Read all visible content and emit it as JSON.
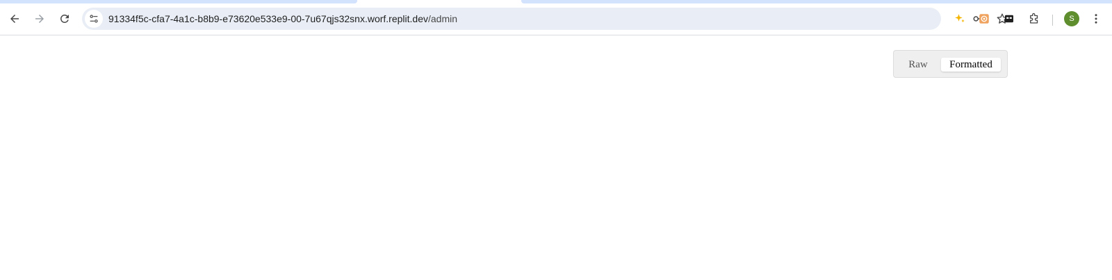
{
  "browser": {
    "url_host": "91334f5c-cfa7-4a1c-b8b9-e73620e533e9-00-7u67qjs32snx.worf.replit.dev",
    "url_path": "/admin",
    "profile_initial": "S",
    "icons": {
      "back": "back-arrow-icon",
      "forward": "forward-arrow-icon",
      "reload": "reload-icon",
      "site_info": "tune-icon",
      "password": "key-icon",
      "bookmark": "star-icon",
      "extensions": [
        "sparkle-icon",
        "orange-extension-icon",
        "dark-extension-icon",
        "puzzle-icon"
      ],
      "menu": "kebab-menu-icon"
    }
  },
  "viewer": {
    "raw_label": "Raw",
    "formatted_label": "Formatted",
    "selected": "Formatted"
  },
  "colors": {
    "omnibox_bg": "#e9eef6",
    "avatar_bg": "#5e8e2e",
    "tab_accent": "#d3e3fd"
  }
}
